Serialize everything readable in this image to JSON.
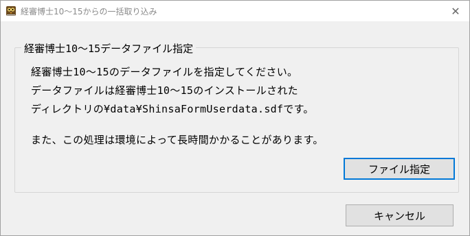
{
  "window": {
    "title": "経審博士10〜15からの一括取り込み",
    "close_glyph": "✕",
    "icon": "app-owl-icon"
  },
  "group": {
    "caption": "経審博士10〜15データファイル指定",
    "lines": [
      "経審博士10〜15のデータファイルを指定してください。",
      "データファイルは経審博士10〜15のインストールされた",
      "ディレクトリの¥data¥ShinsaFormUserdata.sdfです。",
      "また、この処理は環境によって長時間かかることがあります。"
    ],
    "select_file_label": "ファイル指定"
  },
  "footer": {
    "cancel_label": "キャンセル"
  },
  "colors": {
    "accent_focus": "#0078d7",
    "window_bg": "#f0f0f0"
  }
}
